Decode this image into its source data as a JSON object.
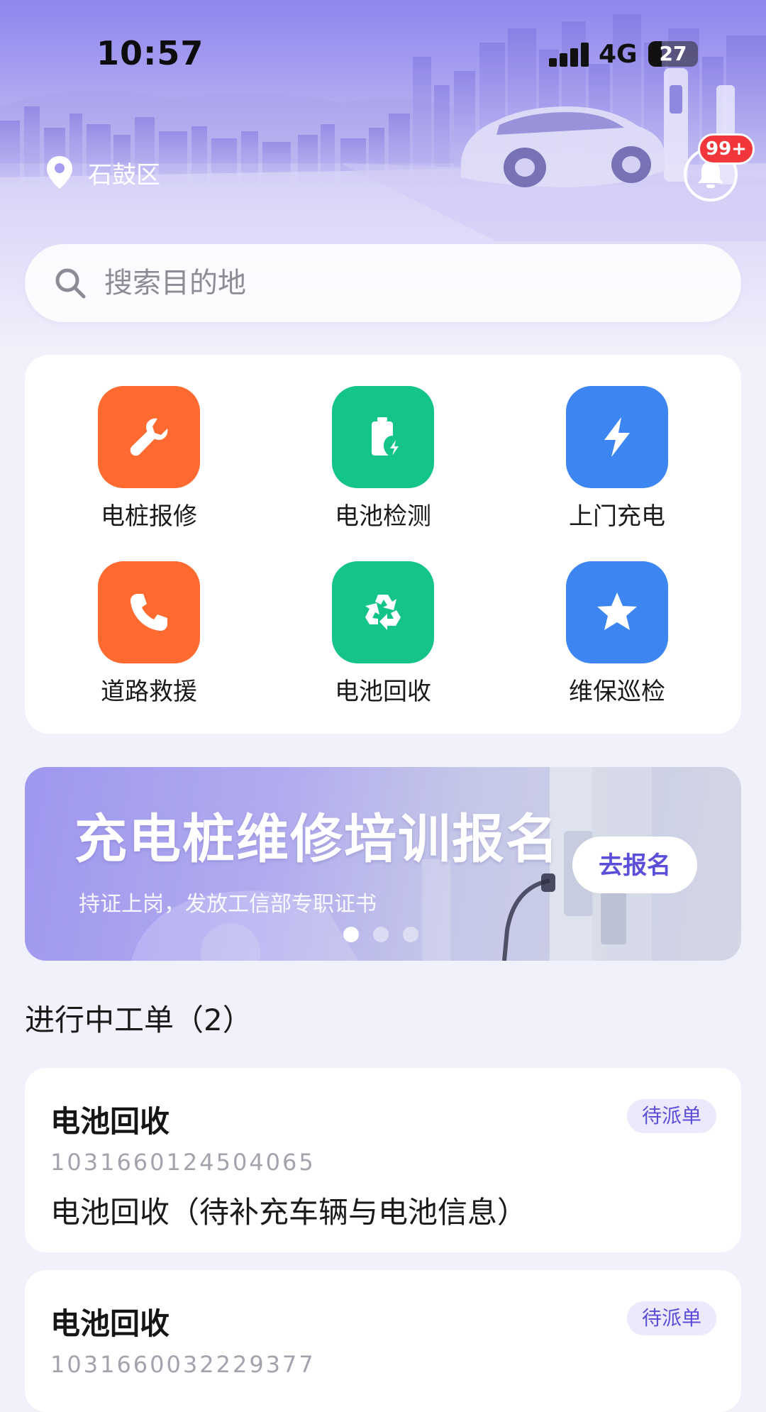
{
  "status_bar": {
    "time": "10:57",
    "network": "4G",
    "battery": "27",
    "battery_level": 27
  },
  "header": {
    "location": "石鼓区",
    "notification_badge": "99+"
  },
  "search": {
    "placeholder": "搜索目的地"
  },
  "services": [
    {
      "label": "电桩报修",
      "icon": "wrench-icon",
      "color": "#ff6a30"
    },
    {
      "label": "电池检测",
      "icon": "battery-charge-icon",
      "color": "#14c48b"
    },
    {
      "label": "上门充电",
      "icon": "lightning-icon",
      "color": "#3d86f2"
    },
    {
      "label": "道路救援",
      "icon": "phone-icon",
      "color": "#ff6a30"
    },
    {
      "label": "电池回收",
      "icon": "recycle-icon",
      "color": "#14c48b"
    },
    {
      "label": "维保巡检",
      "icon": "star-icon",
      "color": "#3d86f2"
    }
  ],
  "banner": {
    "title": "充电桩维修培训报名",
    "subtitle": "持证上岗，发放工信部专职证书",
    "button": "去报名",
    "slide_count": 3,
    "active_slide": 1
  },
  "orders": {
    "section_title": "进行中工单（2）",
    "items": [
      {
        "title": "电池回收",
        "badge": "待派单",
        "number": "1031660124504065",
        "description": "电池回收（待补充车辆与电池信息）"
      },
      {
        "title": "电池回收",
        "badge": "待派单",
        "number": "1031660032229377",
        "description": ""
      }
    ]
  },
  "colors": {
    "accent": "#5b4fd9",
    "orange": "#ff6a30",
    "green": "#14c48b",
    "blue": "#3d86f2",
    "badge_red": "#f1373b"
  }
}
